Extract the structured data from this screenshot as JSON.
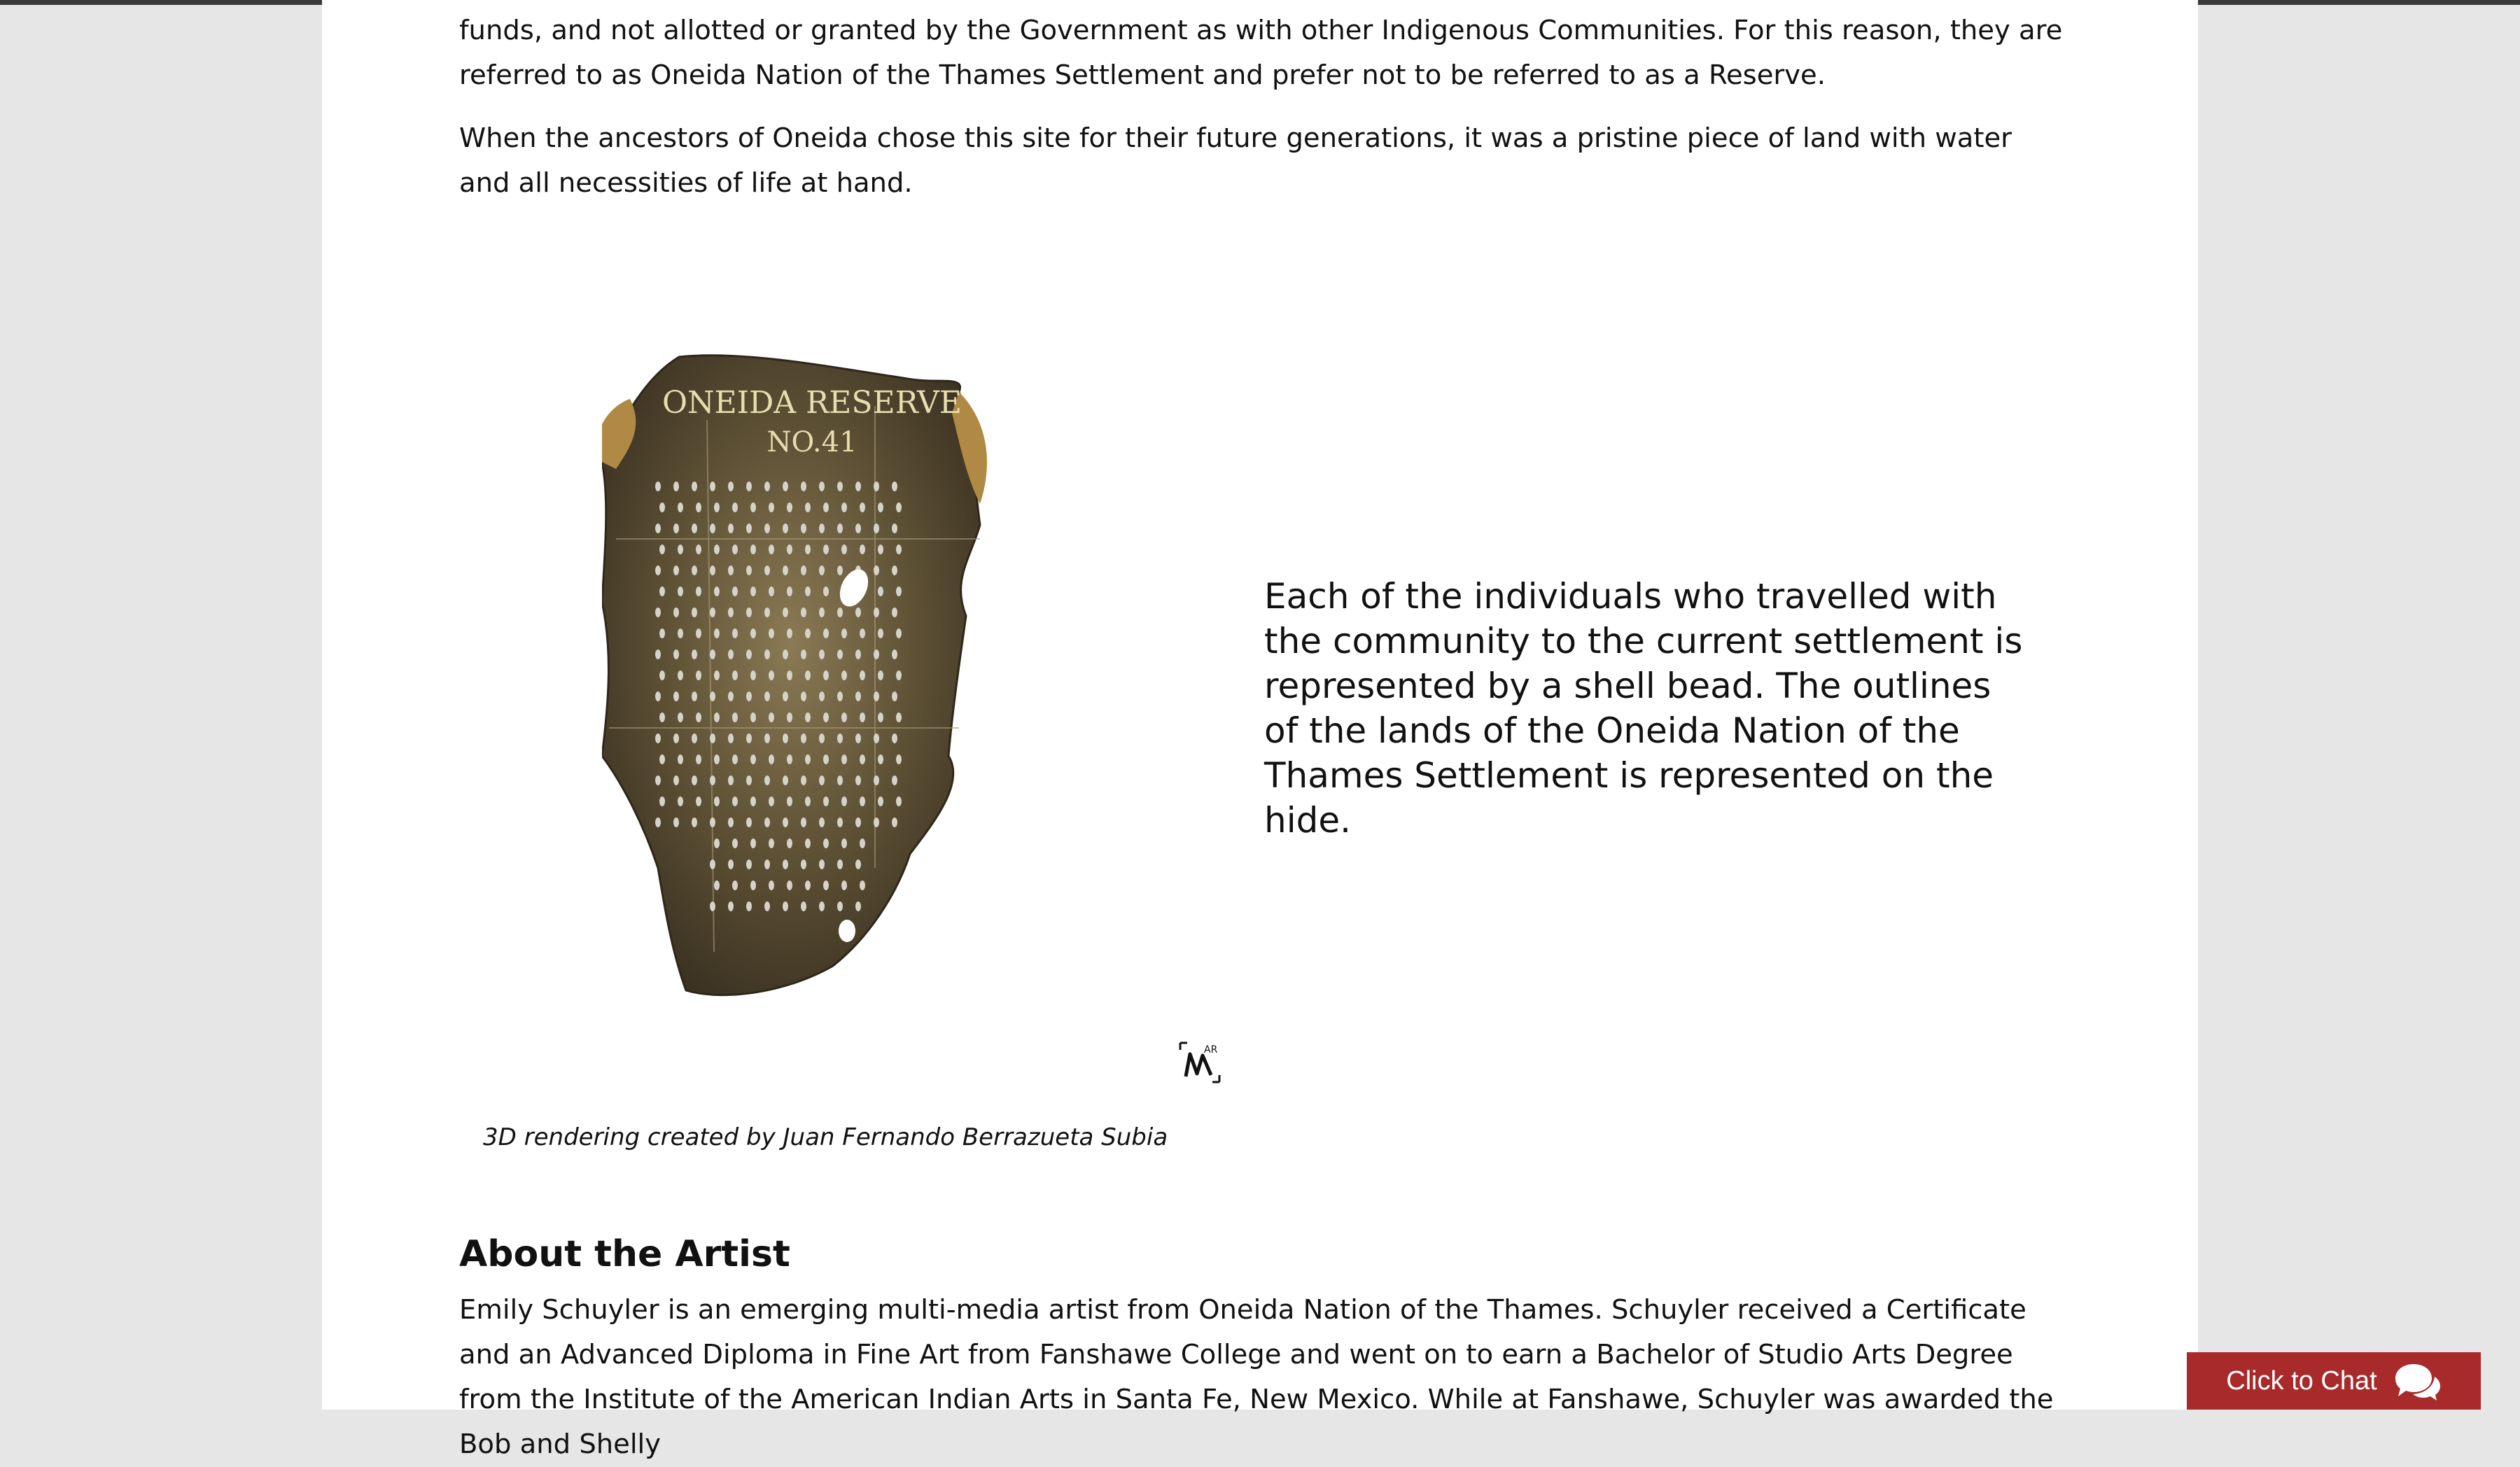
{
  "article": {
    "para1": "funds, and not allotted or granted by the Government as with other Indigenous Communities. For this reason, they are referred to as Oneida Nation of the Thames Settlement and prefer not to be referred to as a Reserve.",
    "para2": "When the ancestors of Oneida chose this site for their future generations, it was a pristine piece of land with water and all necessities of life at hand.",
    "hide_title_line1": "ONEIDA RESERVE",
    "hide_title_line2": "NO.41",
    "side_text": "Each of the individuals who travelled with the community to the current settlement is represented by a shell bead. The outlines of the lands of the Oneida Nation of the Thames Settlement is represented on the hide.",
    "caption": "3D rendering created by Juan Fernando Berrazueta Subia",
    "ar_label": "AR",
    "about_heading": "About the Artist",
    "para3": "Emily Schuyler is an emerging multi-media artist from Oneida Nation of the Thames. Schuyler received a Certificate and an Advanced Diploma in Fine Art from Fanshawe College and went on to earn a Bachelor of Studio Arts Degree from the Institute of the American Indian Arts in Santa Fe, New Mexico. While at Fanshawe, Schuyler was awarded the Bob and Shelly"
  },
  "chat": {
    "label": "Click to Chat",
    "icon": "chat-bubbles-icon"
  },
  "colors": {
    "chat_bg": "#a82a2a",
    "page_bg": "#ffffff",
    "side_bg": "#e6e6e6"
  }
}
